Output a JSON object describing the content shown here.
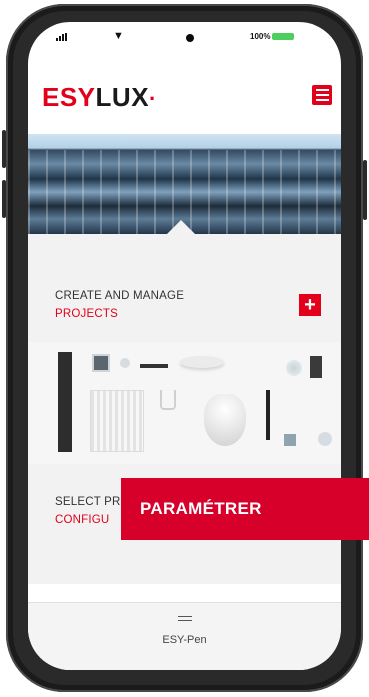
{
  "status_bar": {
    "battery": "100%"
  },
  "header": {
    "logo_main": "ESY",
    "logo_accent": "LUX",
    "logo_dot": "·"
  },
  "section1": {
    "title": "CREATE AND MANAGE",
    "subtitle": "PROJECTS",
    "plus_symbol": "+"
  },
  "section2": {
    "title": "SELECT PRODUCTS AND",
    "subtitle": "CONFIGU"
  },
  "bottom_nav": {
    "label": "ESY-Pen",
    "icon": "sliders-icon"
  },
  "cta": {
    "label": "PARAMÉTRER"
  },
  "colors": {
    "brand_red": "#e2001a",
    "cta_red": "#d7002b"
  }
}
